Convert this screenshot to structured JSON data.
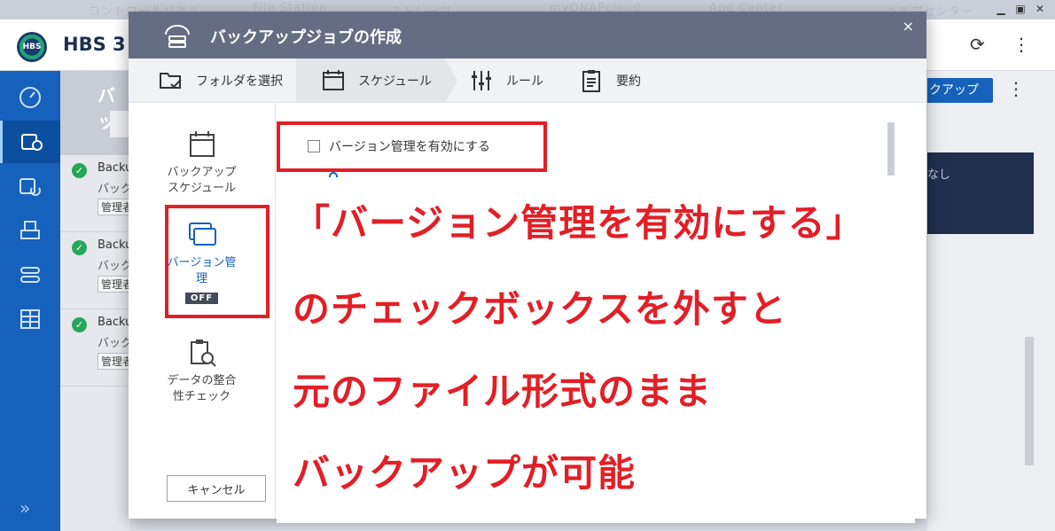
{
  "background": {
    "top_menu_faded": [
      "コントロールパネル",
      "File Station",
      "ストレージ",
      "myQNAPcloud",
      "App Center",
      "ヘルプセンター"
    ],
    "app_title": "HBS 3",
    "logo_text": "HBS",
    "list_title": "バッ",
    "jobs": [
      {
        "name": "Backu",
        "sub": "バック",
        "mode": "管理者"
      },
      {
        "name": "Backu",
        "sub": "バック",
        "mode": "管理者"
      },
      {
        "name": "Backu",
        "sub": "バック",
        "mode": "管理者"
      }
    ],
    "backup_button_label": "クアップ",
    "right_text": "なし",
    "more_icon": "more-vertical-icon",
    "refresh_icon": "refresh-icon",
    "expand_icon": "double-chevron-right-icon"
  },
  "modal": {
    "title": "バックアップジョブの作成",
    "close_label": "×",
    "steps": [
      {
        "label": "フォルダを選択",
        "icon": "folder-check-icon"
      },
      {
        "label": "スケジュール",
        "icon": "calendar-icon"
      },
      {
        "label": "ルール",
        "icon": "sliders-icon"
      },
      {
        "label": "要約",
        "icon": "clipboard-icon"
      }
    ],
    "current_step": "スケジュール",
    "nav": {
      "schedule_line1": "バックアップ",
      "schedule_line2": "スケジュール",
      "versioning_line1": "バージョン管",
      "versioning_line2": "理",
      "versioning_badge": "OFF",
      "integrity_line1": "データの整合",
      "integrity_line2": "性チェック"
    },
    "versioning_checkbox_label": "バージョン管理を有効にする",
    "versioning_checked": false,
    "cancel_label": "キャンセル"
  },
  "annotation": {
    "lines": [
      "「バージョン管理を有効にする」",
      "のチェックボックスを外すと",
      "元のファイル形式のまま",
      "バックアップが可能"
    ],
    "color": "#e21f26"
  },
  "colors": {
    "accent": "#1561bb",
    "modal_header": "#646d83",
    "highlight": "#e21f26"
  }
}
